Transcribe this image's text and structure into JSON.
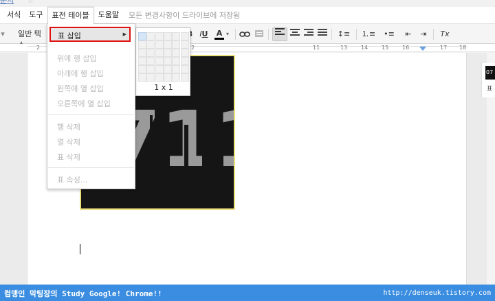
{
  "window": {
    "title_fragment": "문서"
  },
  "menubar": {
    "items": [
      "서식",
      "도구",
      "표전 테이블",
      "도움말"
    ],
    "open_item": "표전 테이블",
    "save_status": "모든 변경사항이 드라이브에 저장됨"
  },
  "toolbar": {
    "style_select": "일반 텍스",
    "bold": "B",
    "italic": "I",
    "underline": "U",
    "text_color": "A",
    "clear_formatting": "Tx"
  },
  "ruler": {
    "numbers": [
      "2",
      "2",
      "11",
      "13",
      "14",
      "15",
      "16",
      "17",
      "18"
    ]
  },
  "table_menu": {
    "insert_table": "표 삽입",
    "items": [
      {
        "label": "위에 행 삽입",
        "enabled": false
      },
      {
        "label": "아래에 행 삽입",
        "enabled": false
      },
      {
        "label": "왼쪽에 열 삽입",
        "enabled": false
      },
      {
        "label": "오른쪽에 열 삽입",
        "enabled": false
      },
      {
        "label": "행 삭제",
        "enabled": false
      },
      {
        "label": "열 삭제",
        "enabled": false
      },
      {
        "label": "표 삭제",
        "enabled": false
      },
      {
        "label": "표 속성...",
        "enabled": false
      }
    ]
  },
  "grid_picker": {
    "size_label": "1 x 1",
    "rows": 6,
    "cols": 6,
    "selected_rows": 1,
    "selected_cols": 1
  },
  "document": {
    "image_text": "711"
  },
  "right_panel": {
    "thumb_text": "07",
    "label": "표"
  },
  "banner": {
    "left_text": "컴맹인 막팅장의 Study Google! Chrome!!",
    "right_text": "http://denseuk.tistory.com"
  },
  "colors": {
    "accent": "#3a8de0",
    "highlight_border": "#e01010",
    "selection": "#d6e6f7"
  }
}
